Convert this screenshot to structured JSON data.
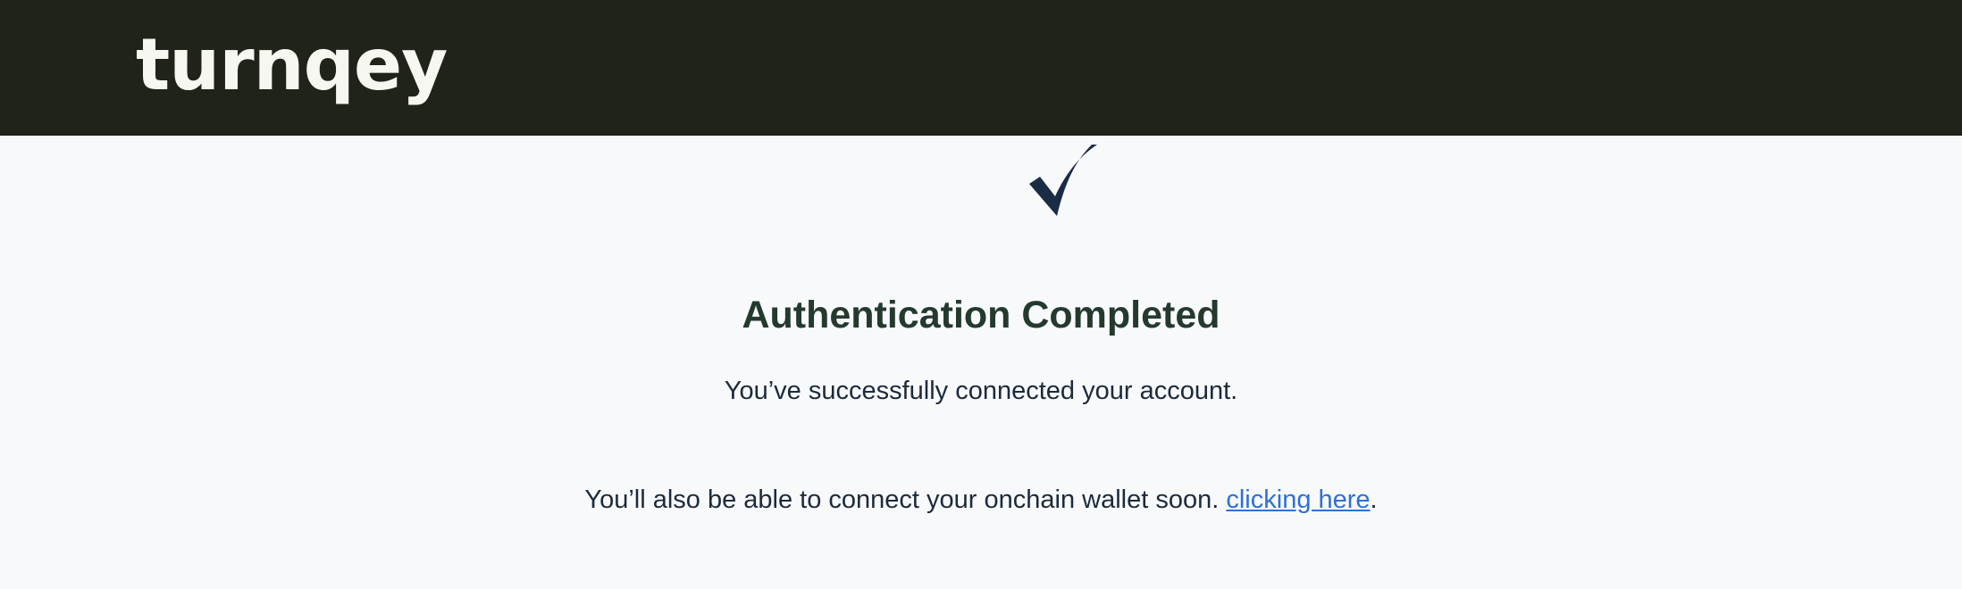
{
  "header": {
    "logo_text": "turnqey"
  },
  "main": {
    "icon": "checkmark-icon",
    "title": "Authentication Completed",
    "subtitle": "You’ve successfully connected your account.",
    "note_text": "You’ll also be able to connect your onchain wallet soon. ",
    "link_text": "clicking here",
    "note_suffix": "."
  },
  "colors": {
    "header_bg": "#1f231a",
    "page_bg": "#f8f9fb",
    "title": "#243a2e",
    "text": "#1c2a3c",
    "link": "#2f6fd8",
    "checkmark": "#1a2b45"
  }
}
